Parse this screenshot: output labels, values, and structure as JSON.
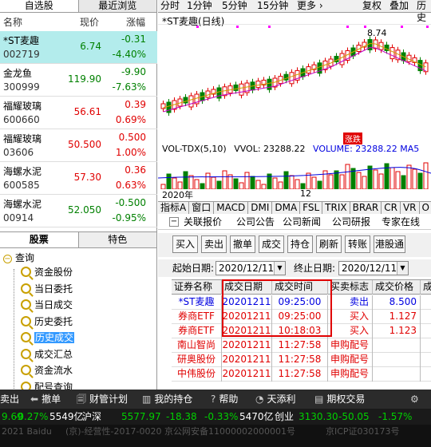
{
  "watchlist": {
    "tabs": [
      "自选股",
      "最近浏览"
    ],
    "headers": {
      "name": "名称",
      "price": "现价",
      "change": "涨幅"
    },
    "rows": [
      {
        "name": "*ST麦趣",
        "code": "002719",
        "price": "6.74",
        "change": "-0.31",
        "pct": "-4.40%",
        "dir": "down",
        "selected": true
      },
      {
        "name": "金龙鱼",
        "code": "300999",
        "price": "119.90",
        "change": "-9.90",
        "pct": "-7.63%",
        "dir": "down",
        "selected": false
      },
      {
        "name": "福耀玻璃",
        "code": "600660",
        "price": "56.61",
        "change": "0.39",
        "pct": "0.69%",
        "dir": "up",
        "selected": false
      },
      {
        "name": "福耀玻璃",
        "code": "03606",
        "price": "50.500",
        "change": "0.500",
        "pct": "1.00%",
        "dir": "up",
        "selected": false
      },
      {
        "name": "海螺水泥",
        "code": "600585",
        "price": "57.30",
        "change": "0.36",
        "pct": "0.63%",
        "dir": "up",
        "selected": false
      },
      {
        "name": "海螺水泥",
        "code": "00914",
        "price": "52.050",
        "change": "-0.500",
        "pct": "-0.95%",
        "dir": "down",
        "selected": false
      }
    ]
  },
  "chart": {
    "tabs": [
      "分时",
      "1分钟",
      "5分钟",
      "15分钟",
      "更多 ›",
      "复权",
      "叠加",
      "历史"
    ],
    "title": "*ST麦趣(日线)",
    "peak_label": "8.74",
    "badge": "涨跌",
    "vol_title": "VOL-TDX(5,10)",
    "vvol_label": "VVOL: 23288.22",
    "vol_value": "VOLUME: 23288.22 MA5",
    "dates": [
      "2020年",
      "12"
    ],
    "indicators": [
      "指标A",
      "窗口",
      "MACD",
      "DMI",
      "DMA",
      "FSL",
      "TRIX",
      "BRAR",
      "CR",
      "VR",
      "O"
    ]
  },
  "tree": {
    "tabs": [
      "股票",
      "特色"
    ],
    "root": "查询",
    "items": [
      "资金股份",
      "当日委托",
      "当日成交",
      "历史委托",
      "历史成交",
      "成交汇总",
      "资金流水",
      "配号查询"
    ],
    "selected_index": 4
  },
  "trade": {
    "nav": [
      "关联报价",
      "公司公告",
      "公司新闻",
      "公司研报",
      "专家在线"
    ],
    "buttons": [
      "买入",
      "卖出",
      "撤单",
      "成交",
      "持仓",
      "刷新",
      "转账",
      "港股通"
    ],
    "start_label": "起始日期:",
    "start_date": "2020/12/11",
    "end_label": "终止日期:",
    "end_date": "2020/12/11",
    "columns": [
      "证券名称",
      "成交日期",
      "成交时间",
      "买卖标志",
      "成交价格",
      "成"
    ],
    "rows": [
      {
        "name": "*ST麦趣",
        "date": "20201211",
        "time": "09:25:00",
        "flag": "卖出",
        "price": "8.500",
        "color": "blue"
      },
      {
        "name": "券商ETF",
        "date": "20201211",
        "time": "09:25:00",
        "flag": "买入",
        "price": "1.127",
        "color": "red"
      },
      {
        "name": "券商ETF",
        "date": "20201211",
        "time": "10:18:03",
        "flag": "买入",
        "price": "1.123",
        "color": "red"
      },
      {
        "name": "南山智尚",
        "date": "20201211",
        "time": "11:27:58",
        "flag": "申购配号",
        "price": "",
        "color": "red"
      },
      {
        "name": "研奥股份",
        "date": "20201211",
        "time": "11:27:58",
        "flag": "申购配号",
        "price": "",
        "color": "red"
      },
      {
        "name": "中伟股份",
        "date": "20201211",
        "time": "11:27:58",
        "flag": "申购配号",
        "price": "",
        "color": "red"
      }
    ]
  },
  "toolbar": {
    "items": [
      "卖出",
      "撤单",
      "财管计划",
      "我的持仓",
      "帮助",
      "天添利",
      "期权交易"
    ]
  },
  "ticker": {
    "items": [
      "9.69",
      "-0.27%",
      "5549亿",
      "沪深",
      "5577.97",
      "-18.38",
      "-0.33%",
      "5470亿",
      "创业",
      "3130.30",
      "-50.05",
      "-1.57%"
    ]
  },
  "footer": {
    "items": [
      "2021 Baidu",
      "(京)-经营性-2017-0020",
      "京公网安备11000002000001号",
      "京ICP证030173号"
    ]
  },
  "colors": {
    "up": "#e00000",
    "down": "#008000",
    "selected_row": "#b3ecec",
    "highlight_border": "#e00000"
  }
}
